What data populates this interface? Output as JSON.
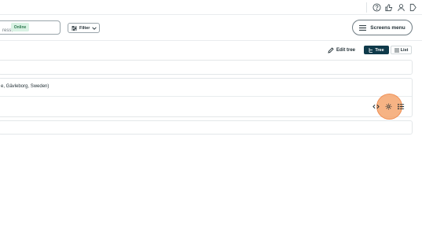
{
  "search": {
    "placeholder": "ress, ID etc.",
    "value": ""
  },
  "toolbar": {
    "filter_label": "Filter",
    "screens_menu_label": "Screens menu"
  },
  "view": {
    "edit_tree_label": "Edit tree",
    "tree_label": "Tree",
    "list_label": "List",
    "active_view": "Tree"
  },
  "tree": {
    "location_text": "e, Gävleborg, Sweden)",
    "status_badge": "Online"
  },
  "colors": {
    "accent": "#0f3a4a",
    "online_bg": "#d9f2e4",
    "online_text": "#2f7a50",
    "click_highlight": "#f5a66e"
  },
  "icons": [
    "help-icon",
    "thumbs-up-icon",
    "user-icon",
    "bookmark-icon",
    "search-icon",
    "filter-icon",
    "chevron-down-icon",
    "menu-icon",
    "pencil-icon",
    "tree-icon",
    "list-icon",
    "code-icon",
    "gear-icon",
    "more-icon"
  ]
}
